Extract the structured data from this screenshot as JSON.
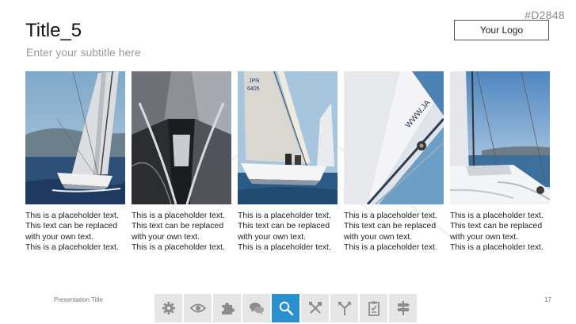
{
  "slide": {
    "code": "#D2848",
    "title": "Title_5",
    "subtitle": "Enter your subtitle here",
    "logo_label": "Your Logo"
  },
  "cards": [
    {
      "photo": "sailboat-heeling-photo",
      "lines": [
        "This is a placeholder text.",
        "This text can be replaced",
        "with your own text.",
        "This is a placeholder text."
      ]
    },
    {
      "photo": "boat-bow-photo",
      "lines": [
        "This is a placeholder text.",
        "This text can be replaced",
        "with your own text.",
        "This is a placeholder text."
      ]
    },
    {
      "photo": "jpn-6405-sailboat-photo",
      "lines": [
        "This is a placeholder text.",
        "This text can be replaced",
        "with your own text.",
        "This is a placeholder text."
      ]
    },
    {
      "photo": "sail-closeup-photo",
      "lines": [
        "This is a placeholder text.",
        "This text can be replaced",
        "with your own text.",
        "This is a placeholder text."
      ]
    },
    {
      "photo": "deck-view-photo",
      "lines": [
        "This is a placeholder text.",
        "This text can be replaced",
        "with your own text.",
        "This is a placeholder text."
      ]
    }
  ],
  "photo_text": {
    "sail_number_country": "JPN",
    "sail_number": "6405",
    "sail_url": "WWW.JA"
  },
  "footer": {
    "presentation_title": "Presentation Title",
    "page_number": "17"
  },
  "toolbar": {
    "buttons": [
      {
        "icon": "gear-icon",
        "active": false
      },
      {
        "icon": "eye-icon",
        "active": false
      },
      {
        "icon": "puzzle-icon",
        "active": false
      },
      {
        "icon": "chat-bubbles-icon",
        "active": false
      },
      {
        "icon": "search-icon",
        "active": true
      },
      {
        "icon": "tools-icon",
        "active": false
      },
      {
        "icon": "direction-arrows-icon",
        "active": false
      },
      {
        "icon": "clipboard-icon",
        "active": false
      },
      {
        "icon": "signpost-icon",
        "active": false
      }
    ],
    "active_color": "#2b90d0",
    "button_color": "#e6e6e6"
  }
}
